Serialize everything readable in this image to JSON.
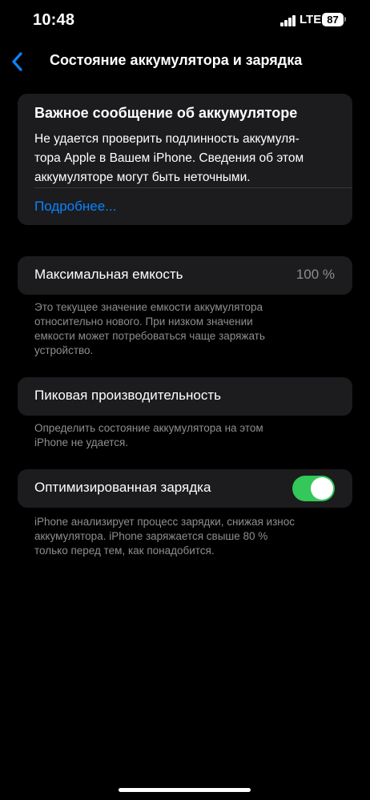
{
  "status_bar": {
    "time": "10:48",
    "network": "LTE",
    "battery_percent": "87"
  },
  "nav": {
    "title": "Состояние аккумулятора и зарядка",
    "back_icon": "chevron-left-icon"
  },
  "battery_message": {
    "title": "Важное сообщение об аккумуляторе",
    "line1": "Не удается проверить подлинность аккумуля-",
    "line2": "тора Apple в Вашем iPhone. Сведения об этом",
    "line3": "аккумуляторе могут быть неточными.",
    "link": "Подробнее..."
  },
  "max_capacity": {
    "label": "Максимальная емкость",
    "value": "100 %",
    "footnote_line1": "Это текущее значение емкости аккумулятора",
    "footnote_line2": "относительно нового. При низком значении",
    "footnote_line3": "емкости может потребоваться чаще заряжать",
    "footnote_line4": "устройство."
  },
  "peak_performance": {
    "label": "Пиковая производительность",
    "footnote_line1": "Определить состояние аккумулятора на этом",
    "footnote_line2": "iPhone не удается."
  },
  "optimized_charging": {
    "label": "Оптимизированная зарядка",
    "enabled": true,
    "footnote_line1": "iPhone анализирует процесс зарядки, снижая износ",
    "footnote_line2": "аккумулятора. iPhone заряжается свыше 80 %",
    "footnote_line3": "только перед тем, как понадобится."
  },
  "colors": {
    "accent": "#0a84ff",
    "toggle_on": "#34c759",
    "card_bg": "#1c1c1e",
    "secondary_text": "#8e8e93"
  }
}
